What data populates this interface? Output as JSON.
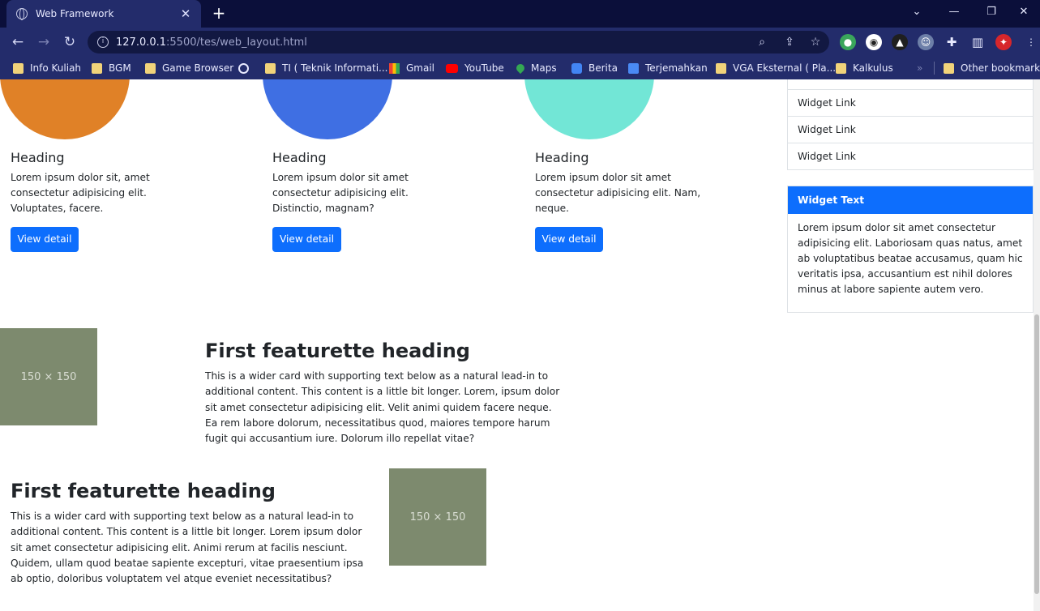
{
  "browser": {
    "tab_title": "Web Framework",
    "tab_close": "✕",
    "new_tab": "+",
    "url_host": "127.0.0.1",
    "url_rest": ":5500/tes/web_layout.html",
    "bookmarks": [
      {
        "label": "Info Kuliah",
        "icon": "folder-icon"
      },
      {
        "label": "BGM",
        "icon": "folder-icon"
      },
      {
        "label": "Game Browser",
        "icon": "folder-icon"
      },
      {
        "label": "",
        "icon": "globe-icon"
      },
      {
        "label": "TI ( Teknik Informati...",
        "icon": "folder-icon"
      },
      {
        "label": "Gmail",
        "icon": "gmail-icon"
      },
      {
        "label": "YouTube",
        "icon": "youtube-icon"
      },
      {
        "label": "Maps",
        "icon": "maps-icon"
      },
      {
        "label": "Berita",
        "icon": "news-icon"
      },
      {
        "label": "Terjemahkan",
        "icon": "translate-icon"
      },
      {
        "label": "VGA Eksternal ( Pla...",
        "icon": "folder-icon"
      },
      {
        "label": "Kalkulus",
        "icon": "folder-icon"
      }
    ],
    "more_bookmarks": "»",
    "other_bookmarks": "Other bookmarks"
  },
  "cards": [
    {
      "heading": "Heading",
      "text": "Lorem ipsum dolor sit, amet consectetur adipisicing elit. Voluptates, facere.",
      "button": "View detail",
      "color": "#e08127"
    },
    {
      "heading": "Heading",
      "text": "Lorem ipsum dolor sit amet consectetur adipisicing elit. Distinctio, magnam?",
      "button": "View detail",
      "color": "#3f6fe3"
    },
    {
      "heading": "Heading",
      "text": "Lorem ipsum dolor sit amet consectetur adipisicing elit. Nam, neque.",
      "button": "View detail",
      "color": "#72e6d6"
    }
  ],
  "sidebar": {
    "links": [
      "Widget Link",
      "Widget Link",
      "Widget Link"
    ],
    "widget_title": "Widget Text",
    "widget_text": "Lorem ipsum dolor sit amet consectetur adipisicing elit. Laboriosam quas natus, amet ab voluptatibus beatae accusamus, quam hic veritatis ipsa, accusantium est nihil dolores minus at labore sapiente autem vero."
  },
  "featurettes": [
    {
      "heading": "First featurette heading",
      "text": "This is a wider card with supporting text below as a natural lead-in to additional content. This content is a little bit longer. Lorem, ipsum dolor sit amet consectetur adipisicing elit. Velit animi quidem facere neque. Ea rem labore dolorum, necessitatibus quod, maiores tempore harum fugit qui accusantium iure. Dolorum illo repellat vitae?",
      "image_label": "150 × 150"
    },
    {
      "heading": "First featurette heading",
      "text": "This is a wider card with supporting text below as a natural lead-in to additional content. This content is a little bit longer. Lorem ipsum dolor sit amet consectetur adipisicing elit. Animi rerum at facilis nesciunt. Quidem, ullam quod beatae sapiente excepturi, vitae praesentium ipsa ab optio, doloribus voluptatem vel atque eveniet necessitatibus?",
      "image_label": "150 × 150"
    }
  ]
}
